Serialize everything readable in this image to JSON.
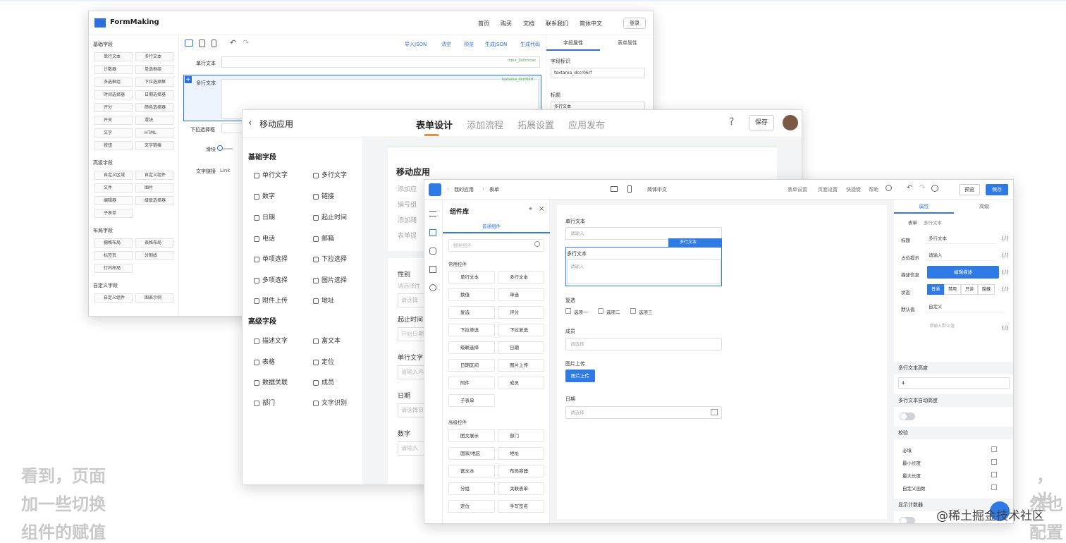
{
  "background": {
    "texts": [
      "看到，页面",
      "加一些切换",
      "组件的赋值",
      "，当",
      "然也",
      "配置"
    ]
  },
  "watermark": "@稀土掘金技术社区",
  "w1": {
    "brand": "FormMaking",
    "nav": [
      "首页",
      "购买",
      "文档",
      "联系我们",
      "简体中文"
    ],
    "login": "登录",
    "sections": {
      "basic": "基础字段",
      "advanced": "高级字段",
      "layout": "布局字段",
      "custom": "自定义字段"
    },
    "basic_items": [
      "单行文本",
      "多行文本",
      "计数器",
      "单选框组",
      "多选框组",
      "下拉选择框",
      "时间选择器",
      "日期选择器",
      "评分",
      "颜色选择器",
      "开关",
      "滑块",
      "文字",
      "HTML",
      "按钮",
      "文字链接"
    ],
    "advanced_items": [
      "自定义区域",
      "自定义组件",
      "文件",
      "图片",
      "编辑器",
      "级联选择器",
      "子表单"
    ],
    "layout_items": [
      "栅格布局",
      "表格布局",
      "标签页",
      "分割线",
      "行内布局"
    ],
    "custom_items": [
      "自定义组件",
      "图表示例"
    ],
    "toolbar": [
      "导入JSON",
      "清空",
      "预览",
      "生成JSON",
      "生成代码"
    ],
    "canvas": {
      "f1": "单行文本",
      "f1_id": "input_Zn0rmsac",
      "f2": "多行文本",
      "f2_id": "textarea_dccr06rf",
      "f3": "下拉选择框",
      "f4": "滑块",
      "f5": "文字链接",
      "f5_val": "Link"
    },
    "prop": {
      "tab1": "字段属性",
      "tab2": "表单属性",
      "id_label": "字段标识",
      "id_value": "textarea_dccr06rf",
      "title_label": "标题",
      "title_value": "多行文本"
    }
  },
  "w2": {
    "back": "移动应用",
    "tabs": [
      "表单设计",
      "添加流程",
      "拓展设置",
      "应用发布"
    ],
    "save": "保存",
    "basic_title": "基础字段",
    "basic_fields": [
      "单行文字",
      "多行文字",
      "数字",
      "链接",
      "日期",
      "起止时间",
      "电话",
      "邮箱",
      "单项选择",
      "下拉选择",
      "多项选择",
      "图片选择",
      "附件上传",
      "地址"
    ],
    "adv_title": "高级字段",
    "adv_fields": [
      "描述文字",
      "富文本",
      "表格",
      "定位",
      "数据关联",
      "成员",
      "部门",
      "文字识别"
    ],
    "form_title": "移动应用",
    "form_hints": [
      "添加应",
      "编号组",
      "添加随",
      "表单提"
    ],
    "fields": [
      {
        "label": "性别",
        "hint": "请选择性",
        "ph": "请选择"
      },
      {
        "label": "起止时间",
        "ph": "开始日期"
      },
      {
        "label": "单行文字",
        "ph": "请输入内"
      },
      {
        "label": "日期",
        "ph": "请选择日"
      },
      {
        "label": "数字",
        "ph": "请输入"
      }
    ]
  },
  "w3": {
    "crumbs": [
      "我的应用",
      "表单"
    ],
    "lang": "简体中文",
    "top_links": [
      "表单设置",
      "页面设置",
      "快捷键",
      "帮助"
    ],
    "preview": "预览",
    "save": "保存",
    "lib_title": "组件库",
    "lib_tab": "普通组件",
    "lib_search": "搜索组件",
    "common_title": "常用控件",
    "common": [
      "单行文本",
      "多行文本",
      "数值",
      "单选",
      "复选",
      "评分",
      "下拉单选",
      "下拉复选",
      "级联选择",
      "日期",
      "日期区间",
      "图片上传",
      "附件",
      "成员",
      "子表单"
    ],
    "adv_title": "高级控件",
    "adv": [
      "图文展示",
      "部门",
      "国家/地区",
      "地址",
      "富文本",
      "布局容器",
      "分组",
      "关联表单",
      "定位",
      "手写签名"
    ],
    "form": {
      "f1": "单行文本",
      "f1_ph": "请输入",
      "sel_tag": "多行文本",
      "f2": "多行文本",
      "f2_ph": "请输入",
      "f3": "复选",
      "opts": [
        "选项一",
        "选项二",
        "选项三"
      ],
      "f4": "成员",
      "f4_ph": "请选择",
      "f5": "图片上传",
      "f5_btn": "图片上传",
      "f6": "日期",
      "f6_ph": "请选择"
    },
    "prop": {
      "tab1": "属性",
      "tab2": "高级",
      "crumb": "表单",
      "crumb2": "多行文本",
      "title_l": "标题",
      "title_v": "多行文本",
      "ph_l": "占位提示",
      "ph_v": "请输入",
      "desc_l": "描述信息",
      "desc_btn": "编辑描述",
      "state_l": "状态",
      "states": [
        "普通",
        "禁用",
        "只读",
        "隐藏"
      ],
      "default_l": "默认值",
      "default_v": "自定义",
      "default_ph": "请输入默认值",
      "height_sec": "多行文本高度",
      "height_v": "4",
      "auto_sec": "多行文本自动高度",
      "valid_sec": "校验",
      "rules": [
        "必填",
        "最小长度",
        "最大长度",
        "自定义函数"
      ],
      "counter_sec": "显示计数器",
      "brace": "{/}"
    }
  }
}
